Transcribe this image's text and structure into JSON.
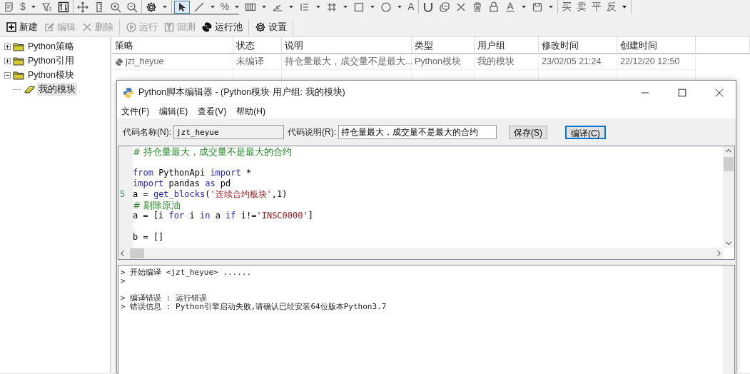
{
  "toolbar": {
    "groups": [
      [
        {
          "kind": "note"
        },
        {
          "label": "$",
          "dropdown": true
        },
        {
          "kind": "filter"
        },
        {
          "kind": "sort"
        }
      ],
      [
        {
          "kind": "move"
        },
        {
          "kind": "ruler"
        },
        {
          "kind": "zoom-in"
        },
        {
          "kind": "zoom-out"
        }
      ],
      [
        {
          "kind": "gear",
          "dropdown": true
        }
      ],
      [
        {
          "kind": "pointer",
          "selected": true
        },
        {
          "kind": "line",
          "dropdown": true,
          "selected": false
        },
        {
          "label": "%",
          "dropdown": true,
          "selected": false
        },
        {
          "kind": "bars",
          "dropdown": true,
          "selected": false
        },
        {
          "kind": "angle",
          "dropdown": true,
          "selected": false
        },
        {
          "kind": "list",
          "dropdown": true,
          "selected": false
        },
        {
          "kind": "grid",
          "dropdown": true,
          "selected": false
        },
        {
          "kind": "rect",
          "dropdown": true,
          "selected": false
        },
        {
          "kind": "circle",
          "dropdown": true,
          "selected": false
        },
        {
          "label": "A",
          "selected": false
        }
      ],
      [
        {
          "kind": "magnet"
        },
        {
          "kind": "copy"
        },
        {
          "kind": "cross"
        },
        {
          "kind": "trash"
        },
        {
          "kind": "lock"
        },
        {
          "kind": "font",
          "dropdown": true
        },
        {
          "kind": "save",
          "dropdown": true
        }
      ],
      [
        {
          "label": "买"
        },
        {
          "label": "卖"
        },
        {
          "label": "平"
        },
        {
          "label": "反"
        },
        {
          "kind": "more"
        }
      ]
    ]
  },
  "actions": {
    "groups": [
      [
        {
          "kind": "plus",
          "label": "新建",
          "disabled": false
        },
        {
          "kind": "edit",
          "label": "编辑",
          "disabled": true
        },
        {
          "kind": "cross",
          "label": "删除",
          "disabled": true
        }
      ],
      [
        {
          "kind": "play",
          "label": "运行",
          "disabled": true
        },
        {
          "kind": "t-box",
          "label": "回测",
          "disabled": true
        },
        {
          "kind": "python",
          "label": "运行池",
          "disabled": false
        }
      ],
      [
        {
          "kind": "gear",
          "label": "设置",
          "disabled": false
        }
      ]
    ]
  },
  "tree": [
    {
      "label": "Python策略",
      "expanded": false,
      "selected": false
    },
    {
      "label": "Python引用",
      "expanded": false,
      "selected": false
    },
    {
      "label": "Python模块",
      "expanded": true,
      "selected": false,
      "children": [
        {
          "label": "我的模块",
          "selected": true
        }
      ]
    }
  ],
  "table": {
    "columns": [
      "策略",
      "状态",
      "说明",
      "类型",
      "用户组",
      "修改时间",
      "创建时间"
    ],
    "rows": [
      [
        "jzt_heyue",
        "未编译",
        "持仓量最大，成交量不是最大...",
        "Python模块",
        "我的模块",
        "23/02/05 21:24",
        "22/12/20 12:50"
      ]
    ]
  },
  "editor": {
    "title": "Python脚本编辑器 - (Python模块 用户组: 我的模块)",
    "menus": [
      "文件(F)",
      "编辑(E)",
      "查看(V)",
      "帮助(H)"
    ],
    "name_label": "代码名称(N):",
    "name_value": "jzt_heyue",
    "desc_label": "代码说明(R):",
    "desc_value": "持仓量最大，成交量不是最大的合约",
    "buttons": [
      {
        "label": "保存(S)",
        "default": false
      },
      {
        "label": "编译(C)",
        "default": true
      }
    ],
    "code": [
      {
        "kind": "code",
        "tokens": [
          {
            "kind": "comment",
            "text": "# 持仓量最大，成交量不是最大的合约"
          }
        ]
      },
      {
        "kind": "blank"
      },
      {
        "kind": "code",
        "tokens": [
          {
            "kind": "keyword",
            "text": "from"
          },
          {
            "kind": "plain",
            "text": " PythonApi "
          },
          {
            "kind": "keyword",
            "text": "import"
          },
          {
            "kind": "plain",
            "text": " *"
          }
        ]
      },
      {
        "kind": "code",
        "tokens": [
          {
            "kind": "keyword",
            "text": "import"
          },
          {
            "kind": "plain",
            "text": " pandas "
          },
          {
            "kind": "keyword",
            "text": "as"
          },
          {
            "kind": "plain",
            "text": " pd"
          }
        ]
      },
      {
        "kind": "code",
        "line_number": "5",
        "tokens": [
          {
            "kind": "plain",
            "text": "a = "
          },
          {
            "kind": "keyword",
            "text": "get_blocks"
          },
          {
            "kind": "plain",
            "text": "("
          },
          {
            "kind": "string",
            "text": "'连续合约板块'"
          },
          {
            "kind": "plain",
            "text": ",1)"
          }
        ]
      },
      {
        "kind": "code",
        "tokens": [
          {
            "kind": "comment",
            "text": "# 剔除原油"
          }
        ]
      },
      {
        "kind": "code",
        "tokens": [
          {
            "kind": "plain",
            "text": "a = [i "
          },
          {
            "kind": "keyword",
            "text": "for"
          },
          {
            "kind": "plain",
            "text": " i "
          },
          {
            "kind": "keyword",
            "text": "in"
          },
          {
            "kind": "plain",
            "text": " a "
          },
          {
            "kind": "keyword",
            "text": "if"
          },
          {
            "kind": "plain",
            "text": " i!="
          },
          {
            "kind": "string",
            "text": "'INSC0000'"
          },
          {
            "kind": "plain",
            "text": "]"
          }
        ]
      },
      {
        "kind": "blank"
      },
      {
        "kind": "code",
        "tokens": [
          {
            "kind": "plain",
            "text": "b = []"
          }
        ]
      }
    ],
    "output": [
      {
        "kind": "text",
        "text": "> 开始编译 <jzt_heyue> ......"
      },
      {
        "kind": "text",
        "text": ">"
      },
      {
        "kind": "blank"
      },
      {
        "kind": "text",
        "text": "> 编译错误 : 运行错误"
      },
      {
        "kind": "text",
        "text": "> 错误信息 : Python引擎启动失败,请确认已经安装64位版本Python3.7"
      }
    ]
  }
}
